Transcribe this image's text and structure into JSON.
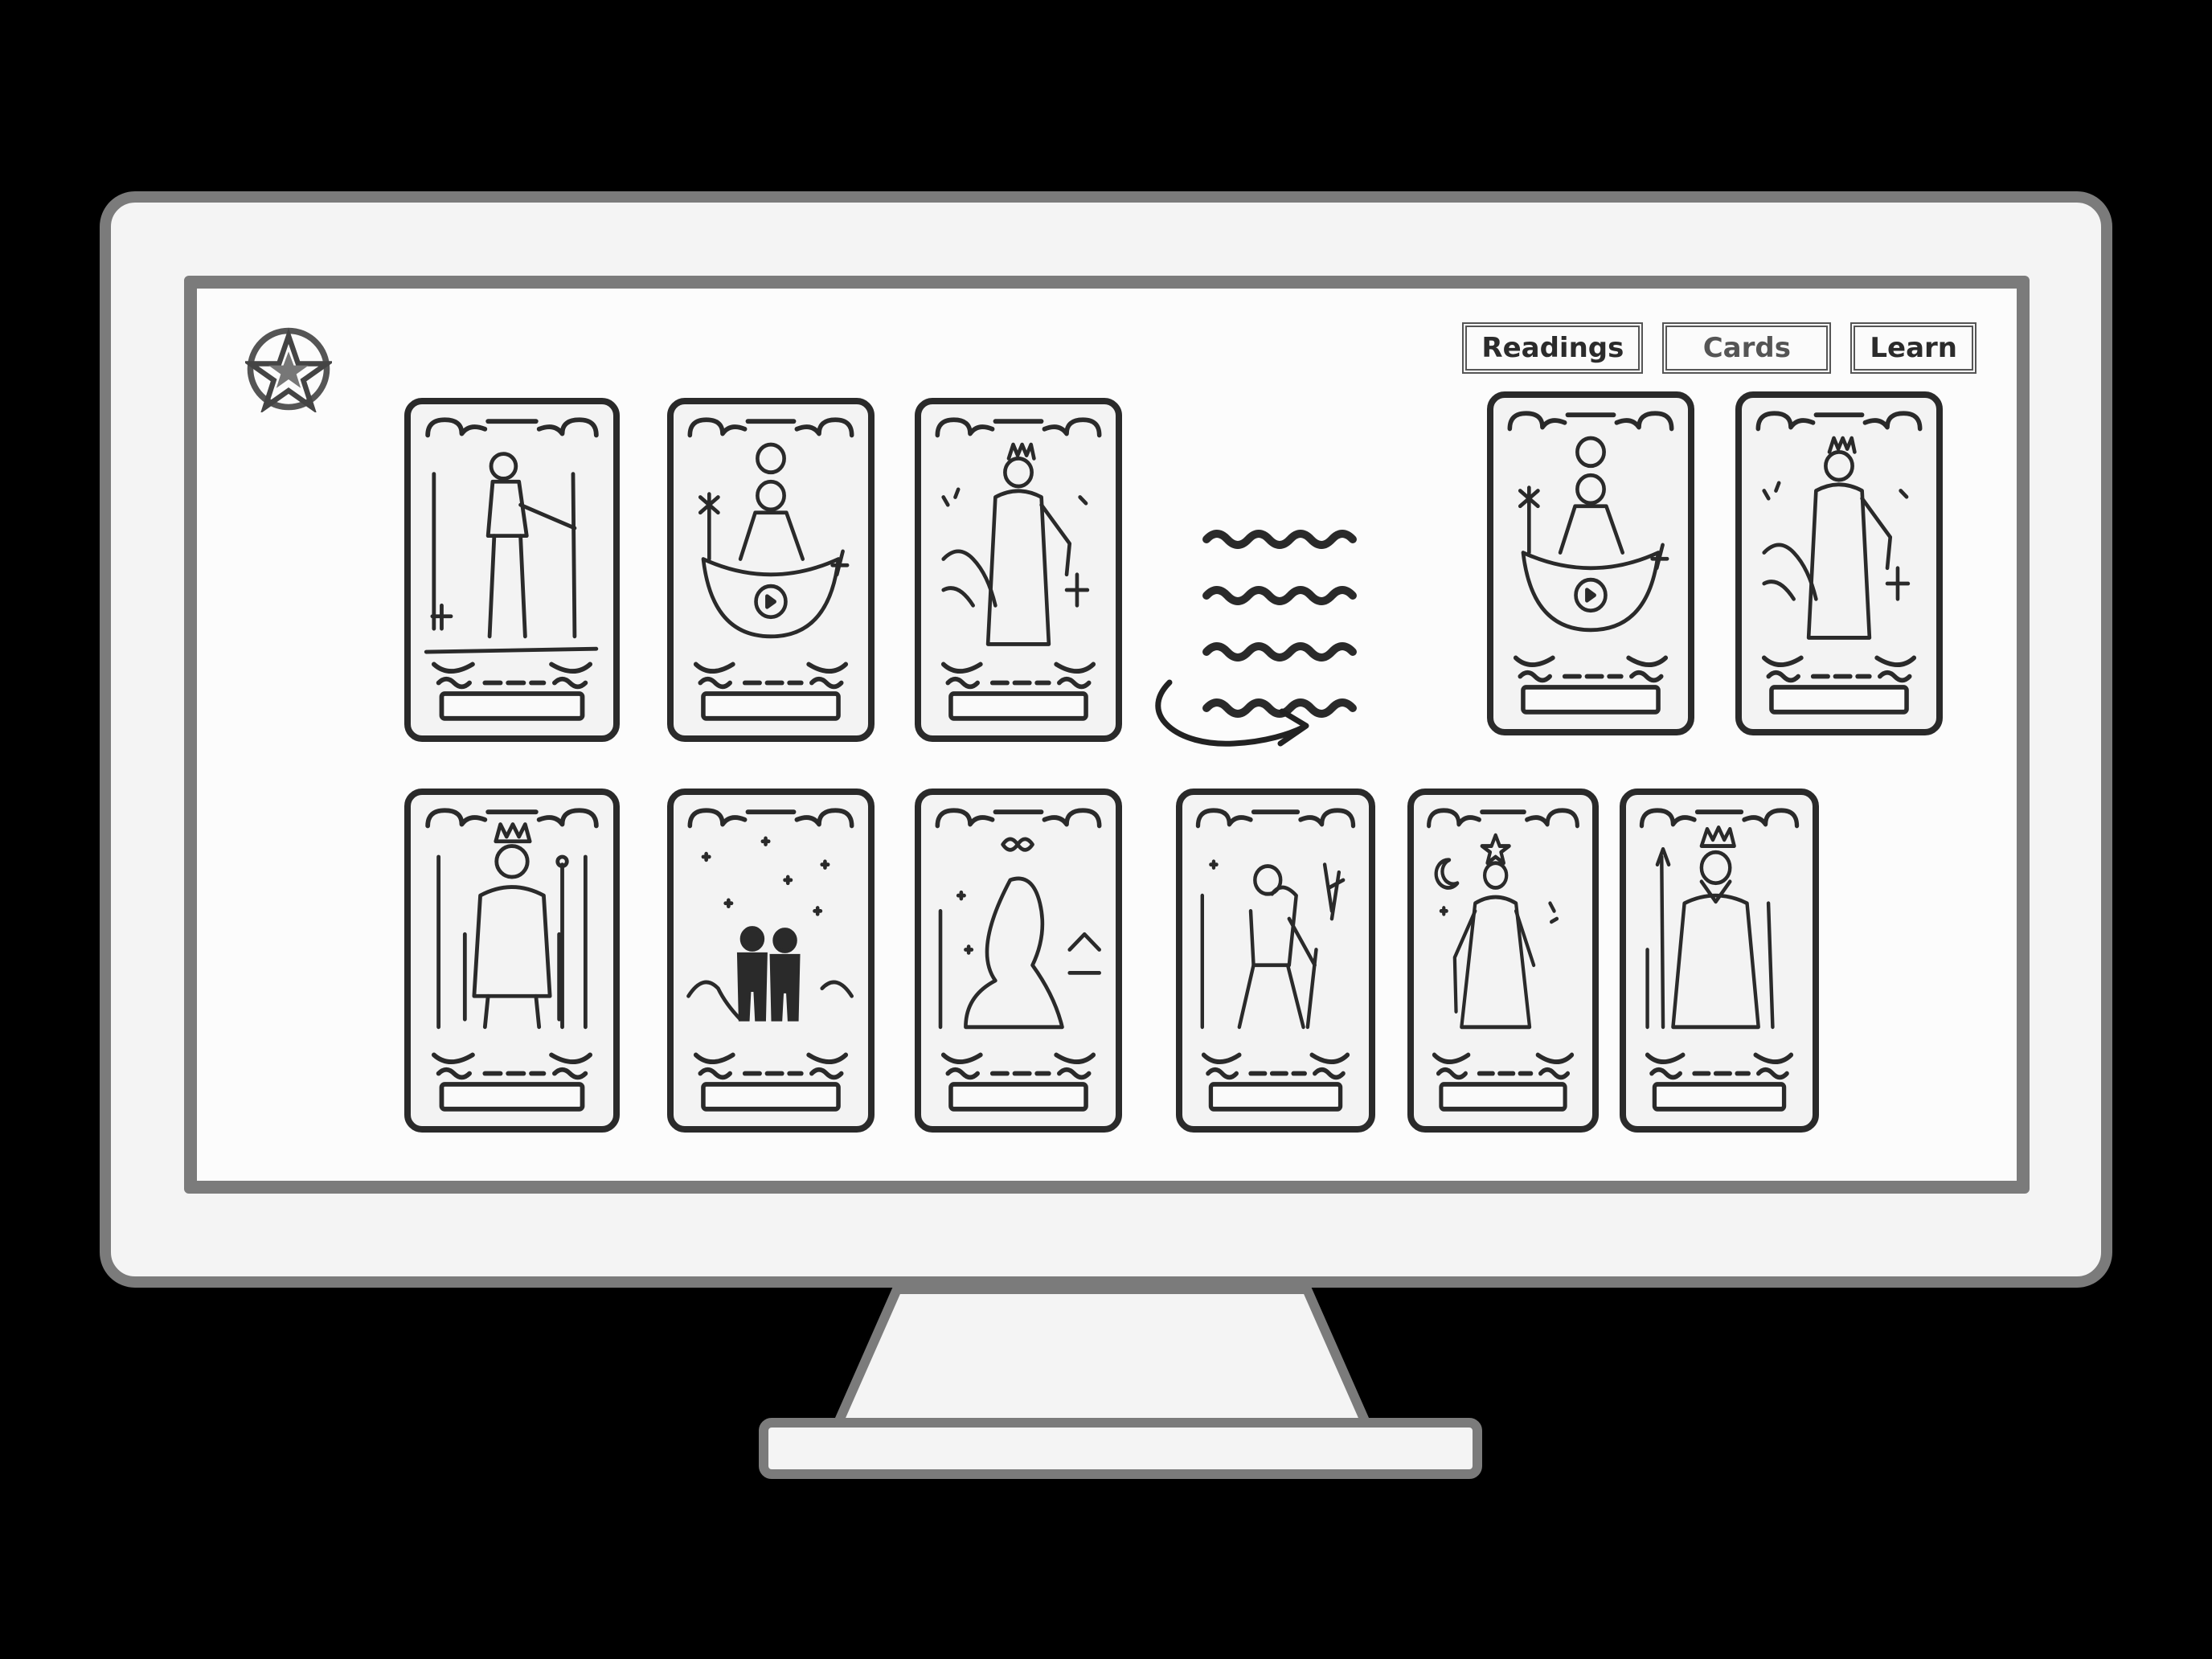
{
  "nav": {
    "readings_label": "Readings",
    "cards_label": "Cards",
    "learn_label": "Learn"
  },
  "logo": {
    "icon": "pentacle-icon"
  },
  "shuffle": {
    "icon": "shuffle-waves-icon",
    "arrow": "curved-arrow-icon"
  },
  "cards": [
    {
      "figure": "standing-figure-with-staff",
      "row": 1
    },
    {
      "figure": "figure-at-cauldron-with-sun",
      "row": 1
    },
    {
      "figure": "crowned-figure-with-cross",
      "row": 1
    },
    {
      "figure": "figure-at-cauldron-with-sun",
      "row": 1
    },
    {
      "figure": "crowned-figure-with-cross",
      "row": 1
    },
    {
      "figure": "enthroned-king-with-staff",
      "row": 2
    },
    {
      "figure": "two-figures-under-stars",
      "row": 2
    },
    {
      "figure": "sphinx-with-infinity",
      "row": 2
    },
    {
      "figure": "walking-figure-with-stick",
      "row": 2
    },
    {
      "figure": "queen-with-moon-and-star",
      "row": 2
    },
    {
      "figure": "emperor-with-sceptre",
      "row": 2
    }
  ],
  "colors": {
    "background": "#000000",
    "bezel": "#f4f4f4",
    "frame": "#7b7b7b",
    "ink": "#2a2a2a"
  }
}
